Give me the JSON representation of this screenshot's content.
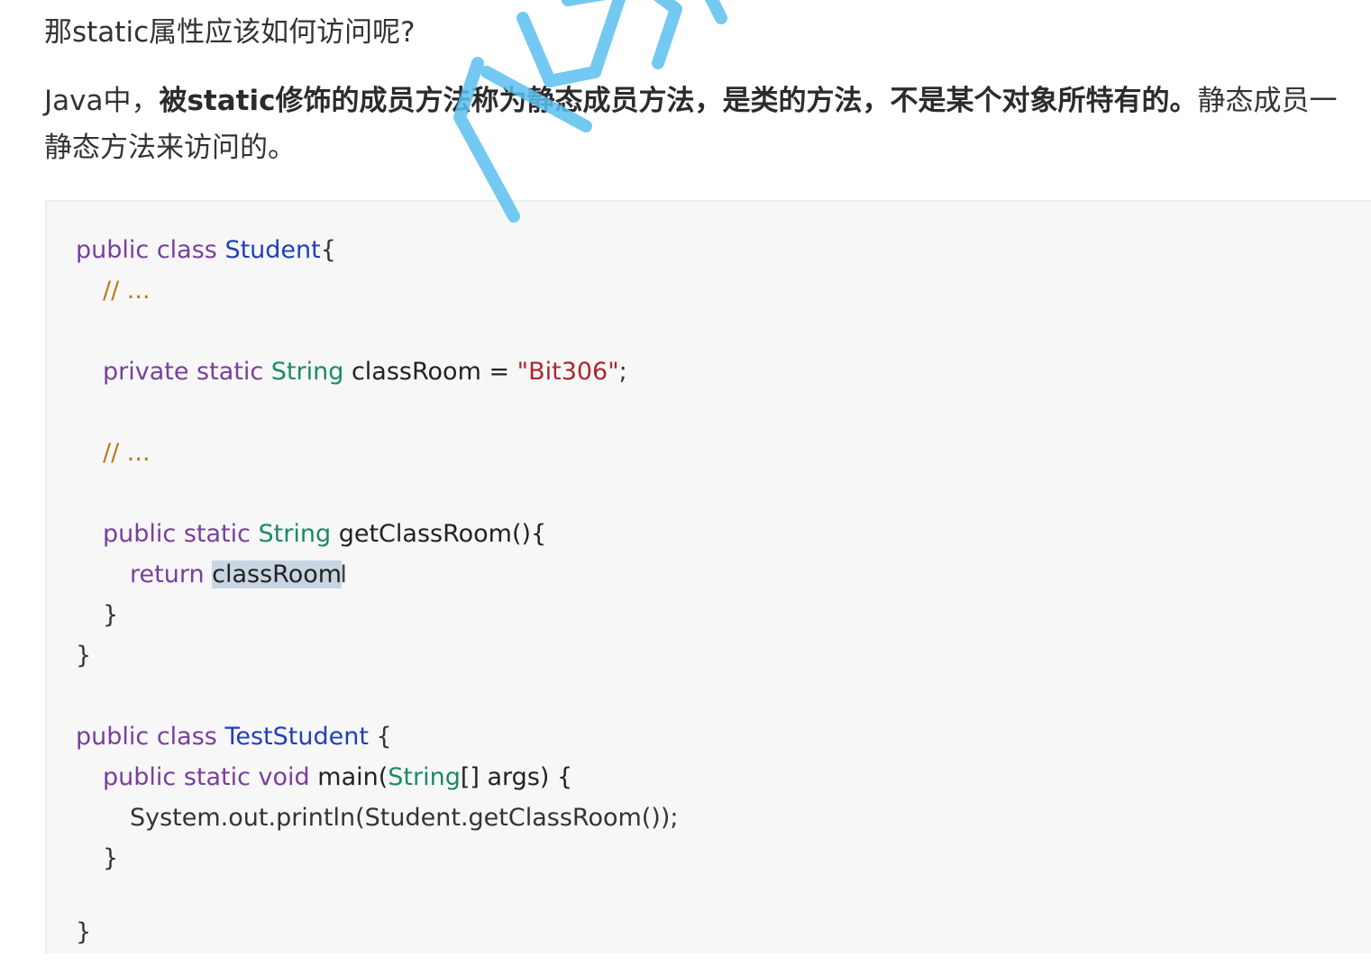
{
  "question": "那static属性应该如何访问呢?",
  "paragraph": {
    "prefix": "Java中，",
    "bold": "被static修饰的成员方法称为静态成员方法，是类的方法，不是某个对象所特有的。",
    "suffix": "静态成员一",
    "line2": "静态方法来访问的。"
  },
  "code": {
    "l1": {
      "kw": "public class",
      "cls": "Student",
      "rest": "{"
    },
    "l2": {
      "cmt": "// ..."
    },
    "l4": {
      "kw": "private static",
      "typ": "String",
      "ident": "classRoom =",
      "str": "\"Bit306\"",
      "rest": ";"
    },
    "l6": {
      "cmt": "// ..."
    },
    "l8": {
      "kw": "public static",
      "typ": "String",
      "rest": "getClassRoom(){"
    },
    "l9": {
      "kw": "return",
      "sel": "classRoom",
      "cursor": "I"
    },
    "l10": "}",
    "l11": "}",
    "l13": {
      "kw": "public class",
      "cls": "TestStudent",
      "rest": "{"
    },
    "l14": {
      "kw": "public static",
      "typ_void": "void",
      "mid": "main(",
      "typ": "String",
      "rest": "[] args) {"
    },
    "l15": "System.out.println(Student.getClassRoom());",
    "l16": "}",
    "l18": "}"
  },
  "watermark": {
    "color": "#5bc0f0"
  }
}
